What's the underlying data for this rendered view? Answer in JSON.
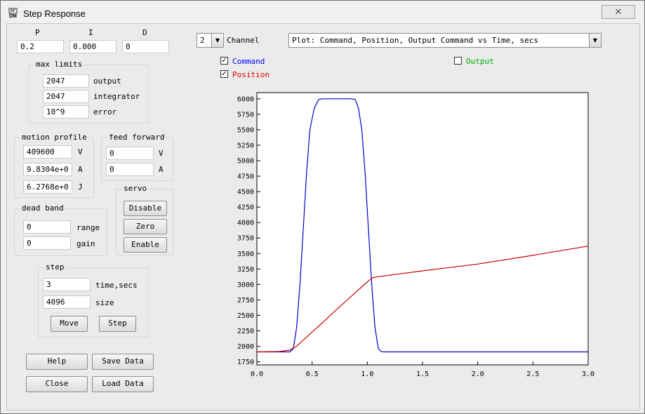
{
  "window": {
    "title": "Step Response",
    "close_glyph": "✕",
    "icon_text": "DM"
  },
  "pid": {
    "p_label": "P",
    "i_label": "I",
    "d_label": "D",
    "p_value": "0.2",
    "i_value": "0.000",
    "d_value": "0"
  },
  "max_limits": {
    "title": "max limits",
    "rows": [
      {
        "value": "2047",
        "label": "output"
      },
      {
        "value": "2047",
        "label": "integrator"
      },
      {
        "value": "10^9",
        "label": "error"
      }
    ]
  },
  "motion_profile": {
    "title": "motion profile",
    "rows": [
      {
        "value": "409600",
        "label": "V"
      },
      {
        "value": "9.8304e+0",
        "label": "A"
      },
      {
        "value": "6.2768e+0",
        "label": "J"
      }
    ]
  },
  "feed_forward": {
    "title": "feed forward",
    "rows": [
      {
        "value": "0",
        "label": "V"
      },
      {
        "value": "0",
        "label": "A"
      }
    ]
  },
  "servo": {
    "title": "servo",
    "disable": "Disable",
    "zero": "Zero",
    "enable": "Enable"
  },
  "dead_band": {
    "title": "dead band",
    "rows": [
      {
        "value": "0",
        "label": "range"
      },
      {
        "value": "0",
        "label": "gain"
      }
    ]
  },
  "step": {
    "title": "step",
    "rows": [
      {
        "value": "3",
        "label": "time,secs"
      },
      {
        "value": "4096",
        "label": "size"
      }
    ],
    "move": "Move",
    "step_btn": "Step"
  },
  "buttons": {
    "help": "Help",
    "save_data": "Save Data",
    "close": "Close",
    "load_data": "Load Data"
  },
  "channel": {
    "value": "2",
    "label": "Channel"
  },
  "plot_select": {
    "value": "Plot: Command, Position, Output Command vs Time, secs"
  },
  "series_toggles": [
    {
      "label": "Command",
      "checked": true,
      "color": "#0000ff"
    },
    {
      "label": "Position",
      "checked": true,
      "color": "#e00000"
    },
    {
      "label": "Output",
      "checked": false,
      "color": "#00b000"
    }
  ],
  "check_glyph": "✓",
  "arrow_glyph": "▼",
  "chart_data": {
    "type": "line",
    "xlim": [
      0,
      3
    ],
    "ylim": [
      1700,
      6100
    ],
    "xticks": [
      0.0,
      0.5,
      1.0,
      1.5,
      2.0,
      2.5,
      3.0
    ],
    "xtick_labels": [
      "0.0",
      "0.5",
      "1.0",
      "1.5",
      "2.0",
      "2.5",
      "3.0"
    ],
    "yticks": [
      1750,
      2000,
      2250,
      2500,
      2750,
      3000,
      3250,
      3500,
      3750,
      4000,
      4250,
      4500,
      4750,
      5000,
      5250,
      5500,
      5750,
      6000
    ],
    "ytick_labels": [
      "1750",
      "2000",
      "2250",
      "2500",
      "2750",
      "3000",
      "3250",
      "3500",
      "3750",
      "4000",
      "4250",
      "4500",
      "4750",
      "5000",
      "5250",
      "5500",
      "5750",
      "6000"
    ],
    "grid": false,
    "series": [
      {
        "name": "Command",
        "color": "#0000cc",
        "x": [
          0.0,
          0.3,
          0.33,
          0.36,
          0.39,
          0.42,
          0.45,
          0.48,
          0.52,
          0.56,
          0.6,
          0.85,
          0.89,
          0.92,
          0.95,
          0.98,
          1.01,
          1.04,
          1.07,
          1.1,
          1.13,
          1.16,
          1.5,
          2.0,
          2.5,
          3.0
        ],
        "y": [
          1910,
          1910,
          1960,
          2300,
          3000,
          3900,
          4800,
          5500,
          5850,
          5990,
          6000,
          6000,
          5990,
          5850,
          5500,
          4800,
          3900,
          3000,
          2300,
          1960,
          1912,
          1910,
          1910,
          1910,
          1910,
          1910
        ]
      },
      {
        "name": "Position",
        "color": "#cc0000",
        "x": [
          0.0,
          0.2,
          0.3,
          0.36,
          0.42,
          0.5,
          0.6,
          0.7,
          0.8,
          0.9,
          0.98,
          1.02,
          1.05,
          1.1,
          1.5,
          2.0,
          2.5,
          3.0
        ],
        "y": [
          1910,
          1915,
          1940,
          2000,
          2100,
          2230,
          2390,
          2560,
          2720,
          2880,
          3010,
          3070,
          3110,
          3125,
          3220,
          3330,
          3470,
          3620
        ]
      }
    ]
  }
}
